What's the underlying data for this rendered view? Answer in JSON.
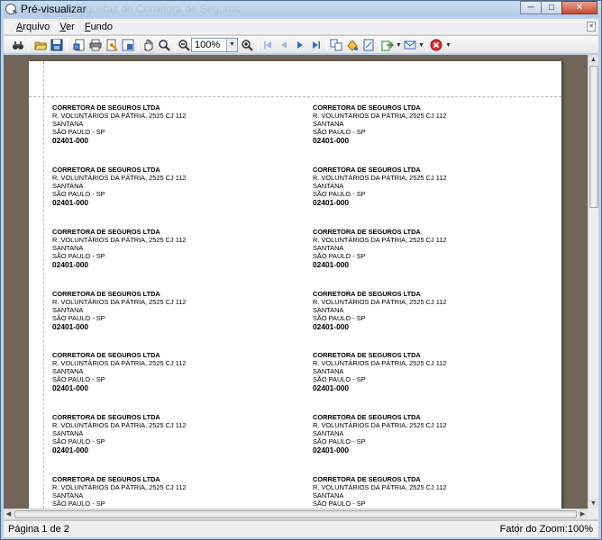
{
  "window": {
    "title": "Pré-visualizar",
    "faded_title": "Etiquetas de Corretora de Seguros",
    "controls": {
      "minimize": "─",
      "maximize": "□",
      "close": "✕"
    }
  },
  "menu": {
    "items": [
      {
        "label_u": "A",
        "label_rest": "rquivo"
      },
      {
        "label_u": "V",
        "label_rest": "er"
      },
      {
        "label_u": "F",
        "label_rest": "undo"
      }
    ]
  },
  "toolbar": {
    "zoom_value": "100%",
    "icons": [
      "binoculars-icon",
      "open-folder-icon",
      "save-icon",
      "page-setup-icon",
      "print-icon",
      "print-options-icon",
      "scale-icon",
      "hand-tool-icon",
      "magnifier-icon",
      "zoom-out-icon",
      "zoom-in-icon",
      "first-page-icon",
      "previous-page-icon",
      "next-page-icon",
      "last-page-icon",
      "multi-page-icon",
      "background-color-icon",
      "watermark-icon",
      "export-icon",
      "email-icon",
      "close-preview-icon"
    ]
  },
  "labels": {
    "company": "CORRETORA DE SEGUROS LTDA",
    "street": "R. VOLUNTÁRIOS DA PÁTRIA, 2525 CJ 112",
    "district": "SANTANA",
    "city": "SÃO PAULO - SP",
    "zip": "02401-000"
  },
  "status": {
    "page_info": "Página 1 de 2",
    "zoom_info": "Fator do Zoom:100%"
  }
}
